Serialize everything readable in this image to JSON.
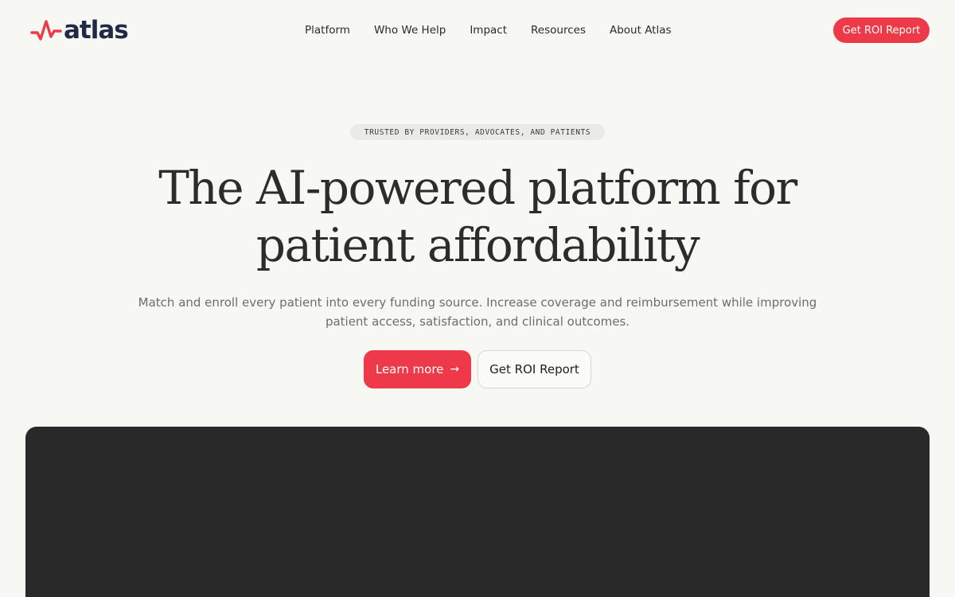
{
  "brand": {
    "name": "atlas",
    "accent_color": "#ee3a48",
    "logo_icon": "pulse-icon"
  },
  "nav": {
    "items": [
      {
        "label": "Platform"
      },
      {
        "label": "Who We Help"
      },
      {
        "label": "Impact"
      },
      {
        "label": "Resources"
      },
      {
        "label": "About Atlas"
      }
    ],
    "cta_label": "Get ROI Report"
  },
  "hero": {
    "badge": "TRUSTED BY PROVIDERS, ADVOCATES, AND PATIENTS",
    "headline_line1": "The AI-powered platform for",
    "headline_line2": "patient affordability",
    "subhead": "Match and enroll every patient into every funding source. Increase coverage and reimbursement while improving patient access, satisfaction, and clinical outcomes.",
    "primary_cta": "Learn more",
    "primary_cta_icon": "arrow-right-icon",
    "secondary_cta": "Get ROI Report"
  },
  "media": {
    "background_color": "#292929"
  }
}
